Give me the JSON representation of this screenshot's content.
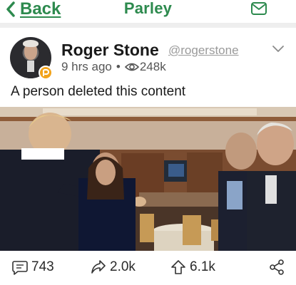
{
  "nav": {
    "back_label": "Back",
    "title": "Parley"
  },
  "post": {
    "author_name": "Roger Stone",
    "author_handle": "@rogerstone",
    "time_ago": "9 hrs ago",
    "separator": "•",
    "views": "248k",
    "text": "A person deleted this content"
  },
  "actions": {
    "comments": "743",
    "echoes": "2.0k",
    "upvotes": "6.1k"
  },
  "colors": {
    "brand": "#2d8a4e",
    "badge": "#f2a31b"
  },
  "icons": [
    "chevron-left-icon",
    "mail-icon",
    "chevron-down-icon",
    "eye-icon",
    "comment-icon",
    "echo-icon",
    "upvote-icon",
    "share-icon"
  ]
}
